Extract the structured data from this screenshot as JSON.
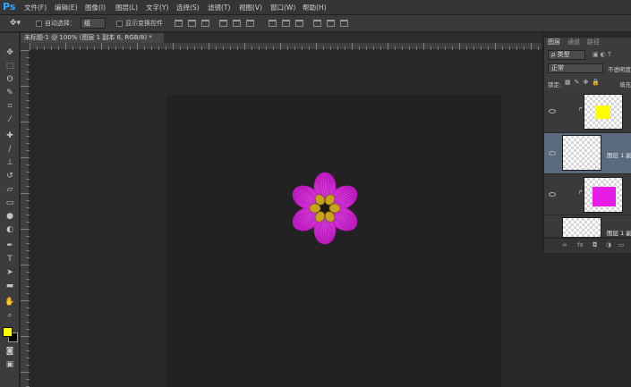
{
  "app": {
    "logo": "Ps"
  },
  "menu": [
    "文件(F)",
    "编辑(E)",
    "图像(I)",
    "图层(L)",
    "文字(Y)",
    "选择(S)",
    "滤镜(T)",
    "视图(V)",
    "窗口(W)",
    "帮助(H)"
  ],
  "options": {
    "auto_select_label": "自动选择：",
    "auto_select_value": "组",
    "show_transform_label": "显示变换控件"
  },
  "document": {
    "tab_title": "未标题-1 @ 100% (图层 1 副本 6, RGB/8) *"
  },
  "layers_panel": {
    "tabs": [
      "图层",
      "通道",
      "路径"
    ],
    "filter_label": "ρ 类型",
    "blend_mode": "正常",
    "opacity_label": "不透明度",
    "lock_label": "锁定:",
    "fill_label": "填充",
    "layer_1_label": "图层 1 副",
    "layer_2_label": "图层 1 副",
    "fx_label": "fx"
  },
  "colors": {
    "foreground": "#ffff00",
    "background": "#000000",
    "petal": "#c118c1",
    "petal_highlight": "#e040e6",
    "center": "#c8a21a",
    "thumb_yellow": "#ffff00",
    "thumb_magenta": "#e81ce8"
  },
  "icons": [
    "move-tool-icon",
    "marquee-tool-icon",
    "lasso-tool-icon",
    "quick-select-icon",
    "crop-tool-icon",
    "eyedropper-icon",
    "healing-brush-icon",
    "brush-tool-icon",
    "clone-stamp-icon",
    "history-brush-icon",
    "eraser-icon",
    "gradient-icon",
    "blur-icon",
    "dodge-icon",
    "pen-tool-icon",
    "type-tool-icon",
    "path-select-icon",
    "shape-tool-icon",
    "hand-tool-icon",
    "zoom-tool-icon",
    "quick-mask-icon",
    "screen-mode-icon"
  ]
}
